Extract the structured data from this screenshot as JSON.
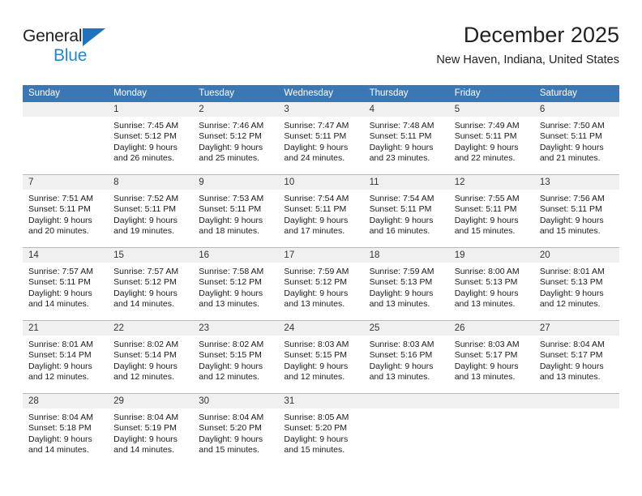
{
  "brand": {
    "line1": "General",
    "line2": "Blue",
    "triangle_color": "#1f72bd",
    "line2_color": "#1f87d8"
  },
  "header": {
    "title": "December 2025",
    "subtitle": "New Haven, Indiana, United States"
  },
  "theme": {
    "header_row_bg": "#3a78b5",
    "header_row_text": "#ffffff",
    "daynum_bg": "#f0f0f0",
    "cell_bg": "#ffffff",
    "grid_line": "#b9b9b9"
  },
  "weekday_headers": [
    "Sunday",
    "Monday",
    "Tuesday",
    "Wednesday",
    "Thursday",
    "Friday",
    "Saturday"
  ],
  "weeks": [
    [
      {
        "day": "",
        "lines": []
      },
      {
        "day": "1",
        "lines": [
          "Sunrise: 7:45 AM",
          "Sunset: 5:12 PM",
          "Daylight: 9 hours",
          "and 26 minutes."
        ]
      },
      {
        "day": "2",
        "lines": [
          "Sunrise: 7:46 AM",
          "Sunset: 5:12 PM",
          "Daylight: 9 hours",
          "and 25 minutes."
        ]
      },
      {
        "day": "3",
        "lines": [
          "Sunrise: 7:47 AM",
          "Sunset: 5:11 PM",
          "Daylight: 9 hours",
          "and 24 minutes."
        ]
      },
      {
        "day": "4",
        "lines": [
          "Sunrise: 7:48 AM",
          "Sunset: 5:11 PM",
          "Daylight: 9 hours",
          "and 23 minutes."
        ]
      },
      {
        "day": "5",
        "lines": [
          "Sunrise: 7:49 AM",
          "Sunset: 5:11 PM",
          "Daylight: 9 hours",
          "and 22 minutes."
        ]
      },
      {
        "day": "6",
        "lines": [
          "Sunrise: 7:50 AM",
          "Sunset: 5:11 PM",
          "Daylight: 9 hours",
          "and 21 minutes."
        ]
      }
    ],
    [
      {
        "day": "7",
        "lines": [
          "Sunrise: 7:51 AM",
          "Sunset: 5:11 PM",
          "Daylight: 9 hours",
          "and 20 minutes."
        ]
      },
      {
        "day": "8",
        "lines": [
          "Sunrise: 7:52 AM",
          "Sunset: 5:11 PM",
          "Daylight: 9 hours",
          "and 19 minutes."
        ]
      },
      {
        "day": "9",
        "lines": [
          "Sunrise: 7:53 AM",
          "Sunset: 5:11 PM",
          "Daylight: 9 hours",
          "and 18 minutes."
        ]
      },
      {
        "day": "10",
        "lines": [
          "Sunrise: 7:54 AM",
          "Sunset: 5:11 PM",
          "Daylight: 9 hours",
          "and 17 minutes."
        ]
      },
      {
        "day": "11",
        "lines": [
          "Sunrise: 7:54 AM",
          "Sunset: 5:11 PM",
          "Daylight: 9 hours",
          "and 16 minutes."
        ]
      },
      {
        "day": "12",
        "lines": [
          "Sunrise: 7:55 AM",
          "Sunset: 5:11 PM",
          "Daylight: 9 hours",
          "and 15 minutes."
        ]
      },
      {
        "day": "13",
        "lines": [
          "Sunrise: 7:56 AM",
          "Sunset: 5:11 PM",
          "Daylight: 9 hours",
          "and 15 minutes."
        ]
      }
    ],
    [
      {
        "day": "14",
        "lines": [
          "Sunrise: 7:57 AM",
          "Sunset: 5:11 PM",
          "Daylight: 9 hours",
          "and 14 minutes."
        ]
      },
      {
        "day": "15",
        "lines": [
          "Sunrise: 7:57 AM",
          "Sunset: 5:12 PM",
          "Daylight: 9 hours",
          "and 14 minutes."
        ]
      },
      {
        "day": "16",
        "lines": [
          "Sunrise: 7:58 AM",
          "Sunset: 5:12 PM",
          "Daylight: 9 hours",
          "and 13 minutes."
        ]
      },
      {
        "day": "17",
        "lines": [
          "Sunrise: 7:59 AM",
          "Sunset: 5:12 PM",
          "Daylight: 9 hours",
          "and 13 minutes."
        ]
      },
      {
        "day": "18",
        "lines": [
          "Sunrise: 7:59 AM",
          "Sunset: 5:13 PM",
          "Daylight: 9 hours",
          "and 13 minutes."
        ]
      },
      {
        "day": "19",
        "lines": [
          "Sunrise: 8:00 AM",
          "Sunset: 5:13 PM",
          "Daylight: 9 hours",
          "and 13 minutes."
        ]
      },
      {
        "day": "20",
        "lines": [
          "Sunrise: 8:01 AM",
          "Sunset: 5:13 PM",
          "Daylight: 9 hours",
          "and 12 minutes."
        ]
      }
    ],
    [
      {
        "day": "21",
        "lines": [
          "Sunrise: 8:01 AM",
          "Sunset: 5:14 PM",
          "Daylight: 9 hours",
          "and 12 minutes."
        ]
      },
      {
        "day": "22",
        "lines": [
          "Sunrise: 8:02 AM",
          "Sunset: 5:14 PM",
          "Daylight: 9 hours",
          "and 12 minutes."
        ]
      },
      {
        "day": "23",
        "lines": [
          "Sunrise: 8:02 AM",
          "Sunset: 5:15 PM",
          "Daylight: 9 hours",
          "and 12 minutes."
        ]
      },
      {
        "day": "24",
        "lines": [
          "Sunrise: 8:03 AM",
          "Sunset: 5:15 PM",
          "Daylight: 9 hours",
          "and 12 minutes."
        ]
      },
      {
        "day": "25",
        "lines": [
          "Sunrise: 8:03 AM",
          "Sunset: 5:16 PM",
          "Daylight: 9 hours",
          "and 13 minutes."
        ]
      },
      {
        "day": "26",
        "lines": [
          "Sunrise: 8:03 AM",
          "Sunset: 5:17 PM",
          "Daylight: 9 hours",
          "and 13 minutes."
        ]
      },
      {
        "day": "27",
        "lines": [
          "Sunrise: 8:04 AM",
          "Sunset: 5:17 PM",
          "Daylight: 9 hours",
          "and 13 minutes."
        ]
      }
    ],
    [
      {
        "day": "28",
        "lines": [
          "Sunrise: 8:04 AM",
          "Sunset: 5:18 PM",
          "Daylight: 9 hours",
          "and 14 minutes."
        ]
      },
      {
        "day": "29",
        "lines": [
          "Sunrise: 8:04 AM",
          "Sunset: 5:19 PM",
          "Daylight: 9 hours",
          "and 14 minutes."
        ]
      },
      {
        "day": "30",
        "lines": [
          "Sunrise: 8:04 AM",
          "Sunset: 5:20 PM",
          "Daylight: 9 hours",
          "and 15 minutes."
        ]
      },
      {
        "day": "31",
        "lines": [
          "Sunrise: 8:05 AM",
          "Sunset: 5:20 PM",
          "Daylight: 9 hours",
          "and 15 minutes."
        ]
      },
      {
        "day": "",
        "lines": []
      },
      {
        "day": "",
        "lines": []
      },
      {
        "day": "",
        "lines": []
      }
    ]
  ]
}
